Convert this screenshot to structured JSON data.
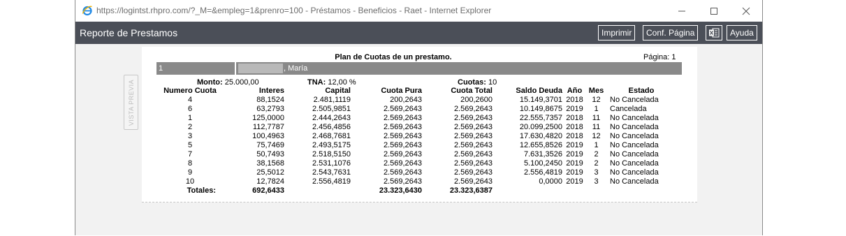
{
  "browser": {
    "url_title": "https://logintst.rhpro.com/?_M=&empleg=1&prenro=100 - Préstamos - Beneficios - Raet - Internet Explorer"
  },
  "app": {
    "title": "Reporte de Prestamos",
    "buttons": {
      "imprimir": "Imprimir",
      "conf_pagina": "Conf. Página",
      "ayuda": "Ayuda"
    }
  },
  "sidebar": {
    "vista_previa": "VISTA PREVIA"
  },
  "report": {
    "title": "Plan de Cuotas de un prestamo.",
    "page_label": "Página:",
    "page_number": "1",
    "employee": {
      "number": "1",
      "name": ", María"
    },
    "summary": {
      "monto_label": "Monto:",
      "monto_value": "25.000,00",
      "tna_label": "TNA:",
      "tna_value": "12,00 %",
      "cuotas_label": "Cuotas:",
      "cuotas_value": "10"
    },
    "columns": [
      "Numero Cuota",
      "Interes",
      "Capital",
      "Cuota Pura",
      "Cuota Total",
      "Saldo Deuda",
      "Año",
      "Mes",
      "Estado"
    ],
    "rows": [
      [
        "4",
        "88,1524",
        "2.481,1119",
        "200,2643",
        "200,2600",
        "15.149,3701",
        "2018",
        "12",
        "No Cancelada"
      ],
      [
        "6",
        "63,2793",
        "2.505,9851",
        "2.569,2643",
        "2.569,2643",
        "10.149,8675",
        "2019",
        "1",
        "Cancelada"
      ],
      [
        "1",
        "125,0000",
        "2.444,2643",
        "2.569,2643",
        "2.569,2643",
        "22.555,7357",
        "2018",
        "11",
        "No Cancelada"
      ],
      [
        "2",
        "112,7787",
        "2.456,4856",
        "2.569,2643",
        "2.569,2643",
        "20.099,2500",
        "2018",
        "11",
        "No Cancelada"
      ],
      [
        "3",
        "100,4963",
        "2.468,7681",
        "2.569,2643",
        "2.569,2643",
        "17.630,4820",
        "2018",
        "12",
        "No Cancelada"
      ],
      [
        "5",
        "75,7469",
        "2.493,5175",
        "2.569,2643",
        "2.569,2643",
        "12.655,8526",
        "2019",
        "1",
        "No Cancelada"
      ],
      [
        "7",
        "50,7493",
        "2.518,5150",
        "2.569,2643",
        "2.569,2643",
        "7.631,3526",
        "2019",
        "2",
        "No Cancelada"
      ],
      [
        "8",
        "38,1568",
        "2.531,1076",
        "2.569,2643",
        "2.569,2643",
        "5.100,2450",
        "2019",
        "2",
        "No Cancelada"
      ],
      [
        "9",
        "25,5012",
        "2.543,7631",
        "2.569,2643",
        "2.569,2643",
        "2.556,4819",
        "2019",
        "3",
        "No Cancelada"
      ],
      [
        "10",
        "12,7824",
        "2.556,4819",
        "2.569,2643",
        "2.569,2643",
        "0,0000",
        "2019",
        "3",
        "No Cancelada"
      ]
    ],
    "totals": {
      "label": "Totales:",
      "interes": "692,6433",
      "cuota_pura": "23.323,6430",
      "cuota_total": "23.323,6387"
    }
  },
  "colors": {
    "appbar": "#4b4f58",
    "employee_bar": "#898989",
    "content_bg": "#f2f2f2",
    "ie_blue": "#1e88e5",
    "excel_green": "#ffffff"
  }
}
